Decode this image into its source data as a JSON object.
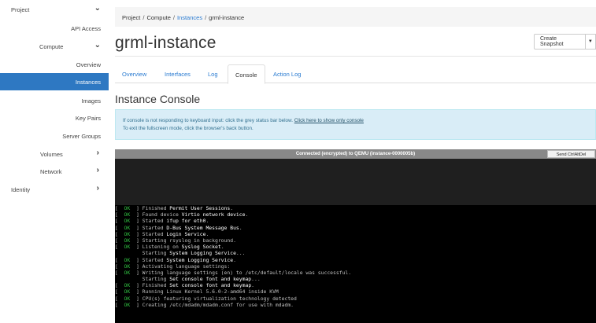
{
  "sidebar": {
    "project": "Project",
    "api_access": "API Access",
    "compute": "Compute",
    "overview": "Overview",
    "instances": "Instances",
    "images": "Images",
    "key_pairs": "Key Pairs",
    "server_groups": "Server Groups",
    "volumes": "Volumes",
    "network": "Network",
    "identity": "Identity"
  },
  "breadcrumb": {
    "project": "Project",
    "compute": "Compute",
    "instances": "Instances",
    "current": "grml-instance",
    "separator": "/"
  },
  "header": {
    "title": "grml-instance",
    "create_snapshot": "Create Snapshot"
  },
  "tabs": [
    "Overview",
    "Interfaces",
    "Log",
    "Console",
    "Action Log"
  ],
  "active_tab": "Console",
  "section_title": "Instance Console",
  "info": {
    "line1_prefix": "If console is not responding to keyboard input: click the grey status bar below.",
    "line1_link": "Click here to show only console",
    "line2": "To exit the fullscreen mode, click the browser's back button."
  },
  "console": {
    "status": "Connected (encrypted) to QEMU (instance-0000005b)",
    "send_cad": "Send CtrlAltDel",
    "lines": [
      {
        "ok": true,
        "text": "Finished ",
        "hl": "Permit User Sessions",
        "tail": "."
      },
      {
        "ok": true,
        "text": "Found device ",
        "hl": "Virtio network device",
        "tail": "."
      },
      {
        "ok": true,
        "text": "Started ",
        "hl": "ifup for eth0",
        "tail": "."
      },
      {
        "ok": true,
        "text": "Started ",
        "hl": "D-Bus System Message Bus",
        "tail": "."
      },
      {
        "ok": true,
        "text": "Started ",
        "hl": "Login Service",
        "tail": "."
      },
      {
        "ok": true,
        "text": "Starting rsyslog in background.",
        "hl": "",
        "tail": ""
      },
      {
        "ok": true,
        "text": "Listening on ",
        "hl": "Syslog Socket",
        "tail": "."
      },
      {
        "ok": false,
        "text": "         Starting ",
        "hl": "System Logging Service",
        "tail": "..."
      },
      {
        "ok": true,
        "text": "Started ",
        "hl": "System Logging Service",
        "tail": "."
      },
      {
        "ok": true,
        "text": "Activating language settings:",
        "hl": "",
        "tail": ""
      },
      {
        "ok": true,
        "text": "Writing language settings (en) to /etc/default/locale was successful.",
        "hl": "",
        "tail": ""
      },
      {
        "ok": false,
        "text": "         Starting ",
        "hl": "Set console font and keymap",
        "tail": "..."
      },
      {
        "ok": true,
        "text": "Finished ",
        "hl": "Set console font and keymap",
        "tail": "."
      },
      {
        "ok": true,
        "text": "Running Linux Kernel 5.6.0-2-amd64 inside KVM",
        "hl": "",
        "tail": ""
      },
      {
        "ok": true,
        "text": "CPU(s) featuring virtualization technology detected",
        "hl": "",
        "tail": ""
      },
      {
        "ok": true,
        "text": "Creating /etc/mdadm/mdadm.conf for use with mdadm.",
        "hl": "",
        "tail": ""
      }
    ]
  }
}
